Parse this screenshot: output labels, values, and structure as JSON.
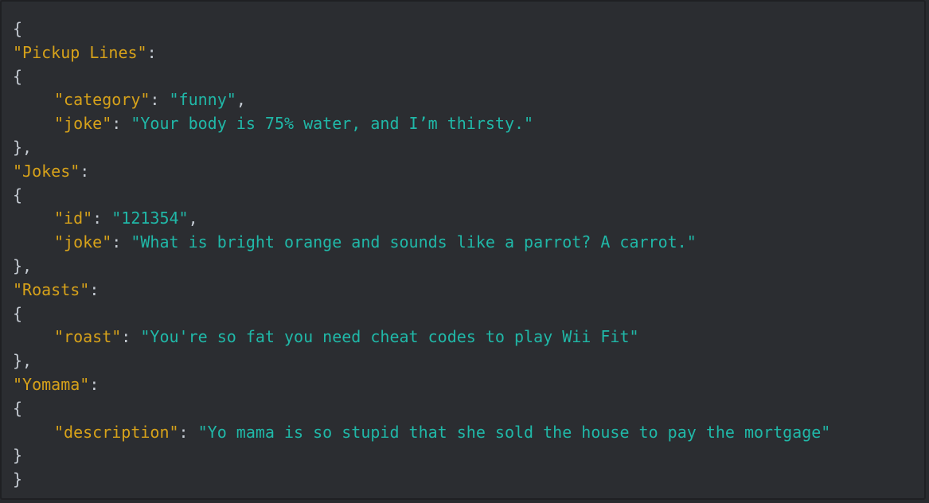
{
  "colors": {
    "background": "#2b2d31",
    "key": "#d7a21a",
    "string": "#20b8a8",
    "punctuation": "#c5cbd3"
  },
  "sections": [
    {
      "name": "\"Pickup Lines\"",
      "fields": [
        {
          "key": "\"category\"",
          "value": "\"funny\"",
          "comma": ","
        },
        {
          "key": "\"joke\"",
          "value": "\"Your body is 75% water, and I’m thirsty.\"",
          "comma": ""
        }
      ],
      "closing": "},"
    },
    {
      "name": "\"Jokes\"",
      "fields": [
        {
          "key": "\"id\"",
          "value": "\"121354\"",
          "comma": ","
        },
        {
          "key": "\"joke\"",
          "value": "\"What is bright orange and sounds like a parrot? A carrot.\"",
          "comma": ""
        }
      ],
      "closing": "},"
    },
    {
      "name": "\"Roasts\"",
      "fields": [
        {
          "key": "\"roast\"",
          "value": "\"You're so fat you need cheat codes to play Wii Fit\"",
          "comma": ""
        }
      ],
      "closing": "},"
    },
    {
      "name": "\"Yomama\"",
      "fields": [
        {
          "key": "\"description\"",
          "value": "\"Yo mama is so stupid that she sold the house to pay the mortgage\"",
          "comma": ""
        }
      ],
      "closing": "}"
    }
  ],
  "open_brace": "{",
  "close_brace": "}",
  "colon": ":",
  "key_value_separator": ": "
}
